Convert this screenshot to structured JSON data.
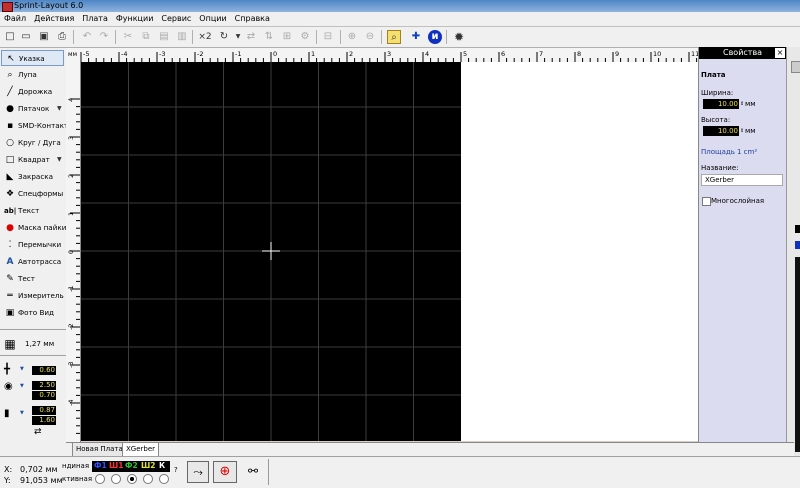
{
  "window": {
    "title": "Sprint-Layout 6.0"
  },
  "menu": [
    "Файл",
    "Действия",
    "Плата",
    "Функции",
    "Сервис",
    "Опции",
    "Справка"
  ],
  "toolbar": {
    "icons": [
      "new-icon",
      "open-icon",
      "save-icon",
      "print-icon",
      "undo-icon",
      "redo-icon",
      "cut-icon",
      "copy-icon",
      "paste-icon",
      "delete-icon",
      "x2",
      "rotate-icon",
      "mirror-h-icon",
      "mirror-v-icon",
      "align-icon",
      "group-icon",
      "ungroup-icon",
      "lock-icon",
      "unlock-icon",
      "search-icon",
      "snap-icon",
      "info-icon",
      "settings-icon"
    ],
    "x2_label": "×2"
  },
  "tools": [
    {
      "icon": "arrow-icon",
      "label": "Указка",
      "selected": true,
      "arrow": false
    },
    {
      "icon": "magnifier-icon",
      "label": "Лупа",
      "selected": false,
      "arrow": false
    },
    {
      "icon": "track-icon",
      "label": "Дорожка",
      "selected": false,
      "arrow": false
    },
    {
      "icon": "pad-icon",
      "label": "Пятачок",
      "selected": false,
      "arrow": true
    },
    {
      "icon": "smd-icon",
      "label": "SMD-Контакт",
      "selected": false,
      "arrow": false
    },
    {
      "icon": "circle-icon",
      "label": "Круг / Дуга",
      "selected": false,
      "arrow": false
    },
    {
      "icon": "square-icon",
      "label": "Квадрат",
      "selected": false,
      "arrow": true
    },
    {
      "icon": "fill-icon",
      "label": "Закраска",
      "selected": false,
      "arrow": false
    },
    {
      "icon": "specforms-icon",
      "label": "Спецформы",
      "selected": false,
      "arrow": false
    },
    {
      "icon": "text-icon",
      "label": "Текст",
      "selected": false,
      "arrow": false
    },
    {
      "icon": "solder-mask-icon",
      "label": "Маска пайки",
      "selected": false,
      "arrow": false
    },
    {
      "icon": "jumper-icon",
      "label": "Перемычки",
      "selected": false,
      "arrow": false
    },
    {
      "icon": "autoroute-icon",
      "label": "Автотрасса",
      "selected": false,
      "arrow": false
    },
    {
      "icon": "test-icon",
      "label": "Тест",
      "selected": false,
      "arrow": false
    },
    {
      "icon": "measure-icon",
      "label": "Измеритель",
      "selected": false,
      "arrow": false
    },
    {
      "icon": "photo-icon",
      "label": "Фото Вид",
      "selected": false,
      "arrow": false
    }
  ],
  "grid": {
    "label": "1,27 мм"
  },
  "track_width": "0.60",
  "pad_outer": "2.50",
  "pad_inner": "0.70",
  "smd_w": "0.87",
  "smd_h": "1.60",
  "ruler": {
    "unit": "мм",
    "top_labels": [
      "-5",
      "-4",
      "-3",
      "-2",
      "-1",
      "0",
      "1",
      "2",
      "3",
      "4",
      "5",
      "6",
      "7",
      "8",
      "9",
      "10",
      "11",
      "12",
      "13"
    ],
    "left_labels": [
      "5",
      "4",
      "3",
      "2",
      "1",
      "0",
      "-1",
      "-2",
      "-3",
      "-4"
    ]
  },
  "tabs": [
    {
      "label": "Новая Плата",
      "active": false
    },
    {
      "label": "XGerber",
      "active": true
    }
  ],
  "status": {
    "x_label": "X:",
    "x_value": "0,702 мм",
    "y_label": "Y:",
    "y_value": "91,053 мм",
    "layer_line1_prefix": "ндиная",
    "layer_line2_prefix": "ктивная",
    "layers": [
      {
        "label": "Ф1",
        "color": "#3050ff"
      },
      {
        "label": "Ш1",
        "color": "#ff3030"
      },
      {
        "label": "Ф2",
        "color": "#30c030"
      },
      {
        "label": "Ш2",
        "color": "#e0e030"
      },
      {
        "label": "К",
        "color": "#ffffff"
      }
    ],
    "help": "?"
  },
  "properties": {
    "title": "Свойства",
    "close": "×",
    "section": "Плата",
    "width_label": "Ширина:",
    "width_value": "10.00",
    "height_label": "Высота:",
    "height_value": "10.00",
    "unit": "мм",
    "area_label": "Площадь",
    "area_value": "1 cm²",
    "name_label": "Название:",
    "name_value": "XGerber",
    "multilayer_label": "Многослойная"
  },
  "colors": {
    "board": "#000000",
    "grid": "#3c3c3c",
    "panel": "#dcdcf0",
    "value_fg": "#e8e050"
  }
}
